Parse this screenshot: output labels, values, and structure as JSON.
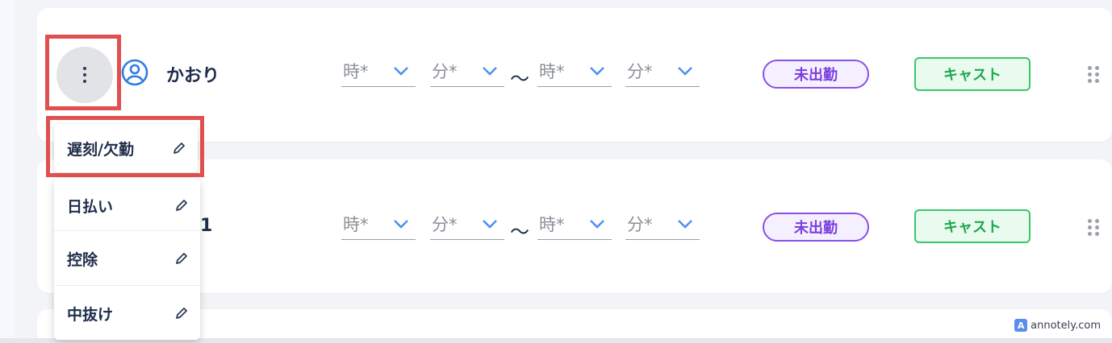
{
  "rows": [
    {
      "name": "かおり",
      "start_hour_placeholder": "時*",
      "start_min_placeholder": "分*",
      "separator": "〜",
      "end_hour_placeholder": "時*",
      "end_min_placeholder": "分*",
      "status": "未出勤",
      "role": "キャスト"
    },
    {
      "name": "1",
      "start_hour_placeholder": "時*",
      "start_min_placeholder": "分*",
      "separator": "〜",
      "end_hour_placeholder": "時*",
      "end_min_placeholder": "分*",
      "status": "未出勤",
      "role": "キャスト"
    }
  ],
  "menu": {
    "items": [
      {
        "label": "遅刻/欠勤",
        "icon": "pencil-icon"
      },
      {
        "label": "日払い",
        "icon": "pencil-icon"
      },
      {
        "label": "控除",
        "icon": "pencil-icon"
      },
      {
        "label": "中抜け",
        "icon": "pencil-icon"
      }
    ]
  },
  "watermark": {
    "text": "annotely.com",
    "logo_letter": "A"
  },
  "colors": {
    "highlight": "#e05050",
    "status_purple": "#8a4fe8",
    "role_green": "#39c66a",
    "avatar_blue": "#2f7de1",
    "chevron_blue": "#4a8ff0"
  }
}
